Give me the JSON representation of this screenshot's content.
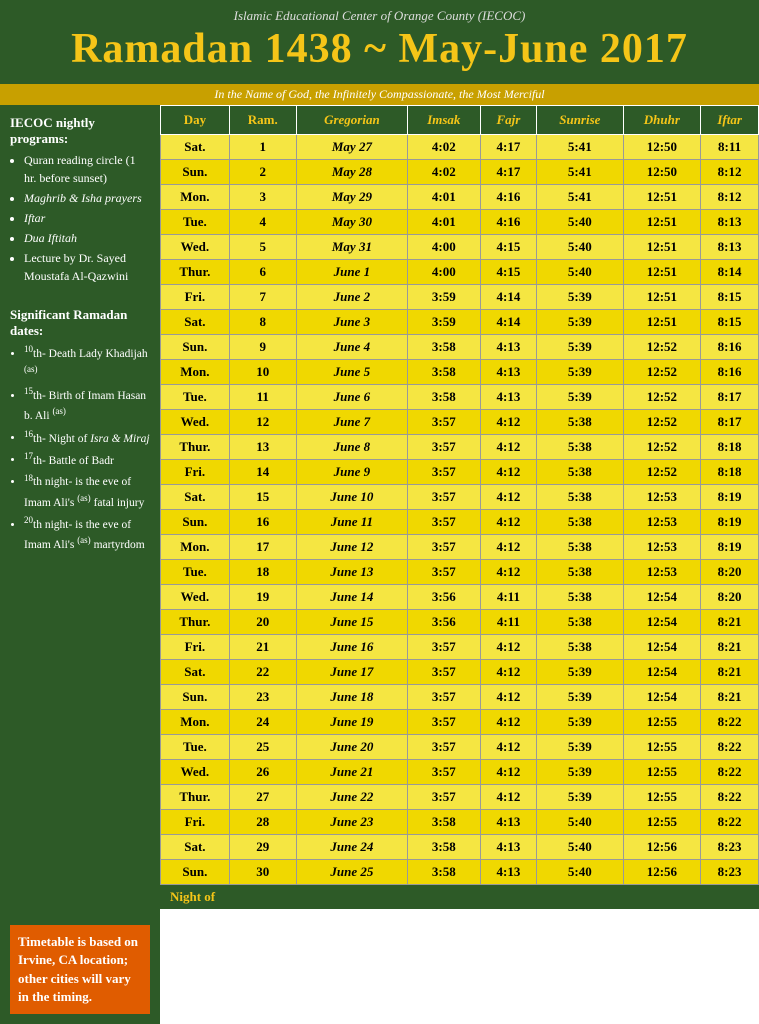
{
  "header": {
    "subtitle": "Islamic Educational Center of Orange County (IECOC)",
    "title": "Ramadan 1438 ~ May-June 2017"
  },
  "bismillah": "In the Name of God, the Infinitely Compassionate, the Most Merciful",
  "sidebar": {
    "programs_title": "IECOC nightly programs:",
    "programs": [
      "Quran reading circle (1 hr. before sunset)",
      "Maghrib & Isha prayers",
      "Iftar",
      "Dua Iftitah",
      "Lecture by Dr. Sayed Moustafa Al-Qazwini"
    ],
    "programs_italic": [
      1,
      2,
      3
    ],
    "dates_title": "Significant Ramadan dates:",
    "dates": [
      "10th- Death Lady Khadijah (as)",
      "15th- Birth of Imam Hasan b. Ali (as)",
      "16th- Night of Isra & Miraj",
      "17th- Battle of Badr",
      "18th night- is the eve of Imam Ali's (as) fatal injury",
      "20th night- is the eve of Imam Ali's (as) martyrdom"
    ],
    "notice": "Timetable is based on Irvine, CA location; other cities will vary in the timing."
  },
  "table": {
    "columns": [
      "Day",
      "Ram.",
      "Gregorian",
      "Imsak",
      "Fajr",
      "Sunrise",
      "Dhuhr",
      "Iftar"
    ],
    "rows": [
      [
        "Sat.",
        "1",
        "May 27",
        "4:02",
        "4:17",
        "5:41",
        "12:50",
        "8:11"
      ],
      [
        "Sun.",
        "2",
        "May 28",
        "4:02",
        "4:17",
        "5:41",
        "12:50",
        "8:12"
      ],
      [
        "Mon.",
        "3",
        "May 29",
        "4:01",
        "4:16",
        "5:41",
        "12:51",
        "8:12"
      ],
      [
        "Tue.",
        "4",
        "May 30",
        "4:01",
        "4:16",
        "5:40",
        "12:51",
        "8:13"
      ],
      [
        "Wed.",
        "5",
        "May 31",
        "4:00",
        "4:15",
        "5:40",
        "12:51",
        "8:13"
      ],
      [
        "Thur.",
        "6",
        "June 1",
        "4:00",
        "4:15",
        "5:40",
        "12:51",
        "8:14"
      ],
      [
        "Fri.",
        "7",
        "June 2",
        "3:59",
        "4:14",
        "5:39",
        "12:51",
        "8:15"
      ],
      [
        "Sat.",
        "8",
        "June 3",
        "3:59",
        "4:14",
        "5:39",
        "12:51",
        "8:15"
      ],
      [
        "Sun.",
        "9",
        "June 4",
        "3:58",
        "4:13",
        "5:39",
        "12:52",
        "8:16"
      ],
      [
        "Mon.",
        "10",
        "June 5",
        "3:58",
        "4:13",
        "5:39",
        "12:52",
        "8:16"
      ],
      [
        "Tue.",
        "11",
        "June 6",
        "3:58",
        "4:13",
        "5:39",
        "12:52",
        "8:17"
      ],
      [
        "Wed.",
        "12",
        "June 7",
        "3:57",
        "4:12",
        "5:38",
        "12:52",
        "8:17"
      ],
      [
        "Thur.",
        "13",
        "June 8",
        "3:57",
        "4:12",
        "5:38",
        "12:52",
        "8:18"
      ],
      [
        "Fri.",
        "14",
        "June 9",
        "3:57",
        "4:12",
        "5:38",
        "12:52",
        "8:18"
      ],
      [
        "Sat.",
        "15",
        "June 10",
        "3:57",
        "4:12",
        "5:38",
        "12:53",
        "8:19"
      ],
      [
        "Sun.",
        "16",
        "June 11",
        "3:57",
        "4:12",
        "5:38",
        "12:53",
        "8:19"
      ],
      [
        "Mon.",
        "17",
        "June 12",
        "3:57",
        "4:12",
        "5:38",
        "12:53",
        "8:19"
      ],
      [
        "Tue.",
        "18",
        "June 13",
        "3:57",
        "4:12",
        "5:38",
        "12:53",
        "8:20"
      ],
      [
        "Wed.",
        "19",
        "June 14",
        "3:56",
        "4:11",
        "5:38",
        "12:54",
        "8:20"
      ],
      [
        "Thur.",
        "20",
        "June 15",
        "3:56",
        "4:11",
        "5:38",
        "12:54",
        "8:21"
      ],
      [
        "Fri.",
        "21",
        "June 16",
        "3:57",
        "4:12",
        "5:38",
        "12:54",
        "8:21"
      ],
      [
        "Sat.",
        "22",
        "June 17",
        "3:57",
        "4:12",
        "5:39",
        "12:54",
        "8:21"
      ],
      [
        "Sun.",
        "23",
        "June 18",
        "3:57",
        "4:12",
        "5:39",
        "12:54",
        "8:21"
      ],
      [
        "Mon.",
        "24",
        "June 19",
        "3:57",
        "4:12",
        "5:39",
        "12:55",
        "8:22"
      ],
      [
        "Tue.",
        "25",
        "June 20",
        "3:57",
        "4:12",
        "5:39",
        "12:55",
        "8:22"
      ],
      [
        "Wed.",
        "26",
        "June 21",
        "3:57",
        "4:12",
        "5:39",
        "12:55",
        "8:22"
      ],
      [
        "Thur.",
        "27",
        "June 22",
        "3:57",
        "4:12",
        "5:39",
        "12:55",
        "8:22"
      ],
      [
        "Fri.",
        "28",
        "June 23",
        "3:58",
        "4:13",
        "5:40",
        "12:55",
        "8:22"
      ],
      [
        "Sat.",
        "29",
        "June 24",
        "3:58",
        "4:13",
        "5:40",
        "12:56",
        "8:23"
      ],
      [
        "Sun.",
        "30",
        "June 25",
        "3:58",
        "4:13",
        "5:40",
        "12:56",
        "8:23"
      ]
    ]
  },
  "night_of_label": "Night of"
}
